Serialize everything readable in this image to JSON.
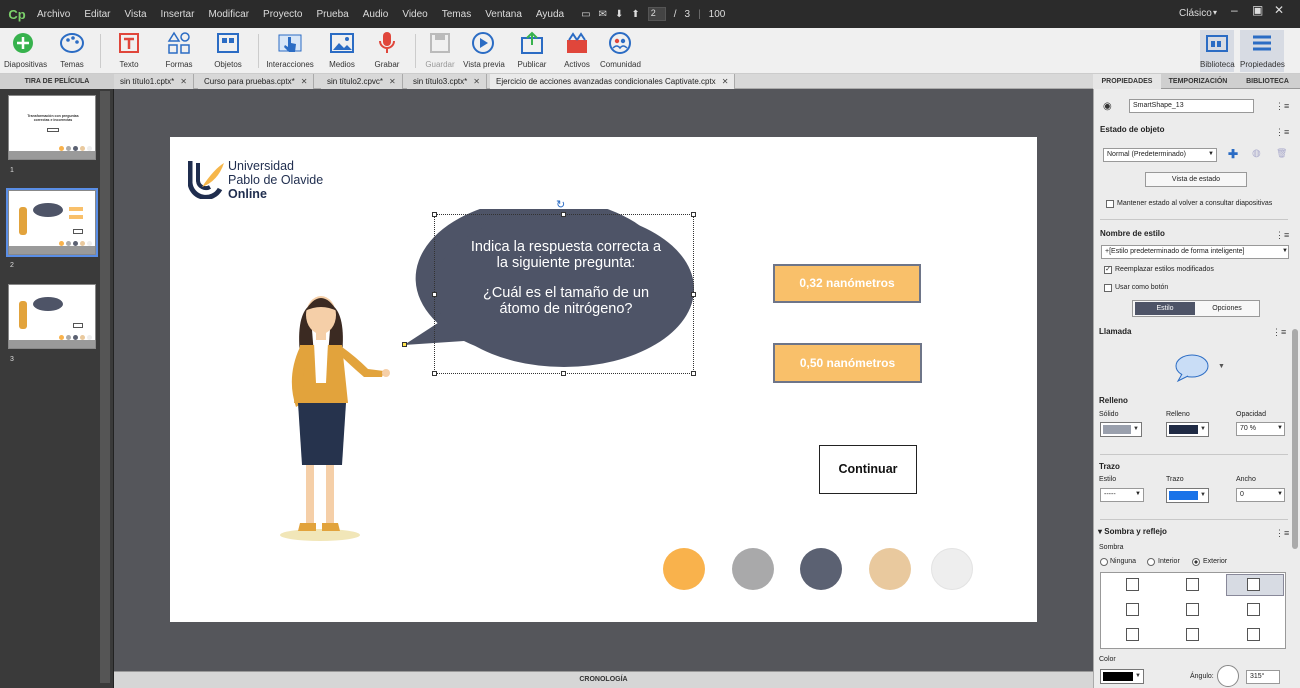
{
  "menubar": {
    "logo": "Cp",
    "items": [
      "Archivo",
      "Editar",
      "Vista",
      "Insertar",
      "Modificar",
      "Proyecto",
      "Prueba",
      "Audio",
      "Video",
      "Temas",
      "Ventana",
      "Ayuda"
    ],
    "page_current": "2",
    "page_sep": "/",
    "page_total": "3",
    "zoom": "100",
    "workspace": "Clásico"
  },
  "toolbar": {
    "items": [
      {
        "label": "Diapositivas"
      },
      {
        "label": "Temas"
      },
      {
        "label": "Texto"
      },
      {
        "label": "Formas"
      },
      {
        "label": "Objetos"
      },
      {
        "label": "Interacciones"
      },
      {
        "label": "Medios"
      },
      {
        "label": "Grabar"
      },
      {
        "label": "Guardar"
      },
      {
        "label": "Vista previa"
      },
      {
        "label": "Publicar"
      },
      {
        "label": "Activos"
      },
      {
        "label": "Comunidad"
      },
      {
        "label": "Biblioteca"
      },
      {
        "label": "Propiedades"
      }
    ]
  },
  "filmstrip": {
    "title": "TIRA DE PELÍCULA",
    "slides": [
      "1",
      "2",
      "3"
    ],
    "thumb1_text": "Transformación con preguntas correctas e incorrectas"
  },
  "tabs": [
    {
      "label": "sin título1.cptx*"
    },
    {
      "label": "Curso para pruebas.cptx*"
    },
    {
      "label": "sin título2.cpvc*"
    },
    {
      "label": "sin título3.cptx*"
    },
    {
      "label": "Ejercicio de acciones avanzadas condicionales Captivate.cptx"
    }
  ],
  "slide": {
    "logo_line1": "Universidad",
    "logo_line2": "Pablo de Olavide",
    "logo_line3": "Online",
    "callout_line1": "Indica la respuesta correcta a la siguiente pregunta:",
    "callout_line2": "¿Cuál es el tamaño de un átomo de nitrógeno?",
    "answer1": "0,32 nanómetros",
    "answer2": "0,50 nanómetros",
    "continue": "Continuar",
    "dot_colors": [
      "#f9b24c",
      "#a9a9aa",
      "#5b6172",
      "#e9c99e",
      "#eeeeee"
    ]
  },
  "timeline": "CRONOLOGÍA",
  "right_tabs": [
    "PROPIEDADES",
    "TEMPORIZACIÓN",
    "BIBLIOTECA"
  ],
  "props": {
    "object_name": "SmartShape_13",
    "estado_title": "Estado de objeto",
    "estado_value": "Normal (Predeterminado)",
    "vista_estado": "Vista de estado",
    "mantener": "Mantener estado al volver a consultar diapositivas",
    "estilo_title": "Nombre de estilo",
    "estilo_value": "+[Estilo predeterminado de forma inteligente]",
    "reemplazar": "Reemplazar estilos modificados",
    "usar_boton": "Usar como botón",
    "seg_estilo": "Estilo",
    "seg_opciones": "Opciones",
    "llamada": "Llamada",
    "relleno_title": "Relleno",
    "solido": "Sólido",
    "relleno": "Relleno",
    "opacidad": "Opacidad",
    "opacidad_value": "70 %",
    "trazo_title": "Trazo",
    "estilo": "Estilo",
    "trazo": "Trazo",
    "ancho": "Ancho",
    "ancho_value": "0",
    "dash": "-----",
    "sombra_title": "Sombra y reflejo",
    "sombra": "Sombra",
    "ninguna": "Ninguna",
    "interior": "Interior",
    "exterior": "Exterior",
    "color": "Color",
    "angulo": "Ángulo:",
    "angulo_value": "315°",
    "fill_solid_color": "#9aa0ad",
    "fill_color": "#1f2a44",
    "stroke_color": "#1a73e8",
    "shadow_color": "#000000"
  }
}
